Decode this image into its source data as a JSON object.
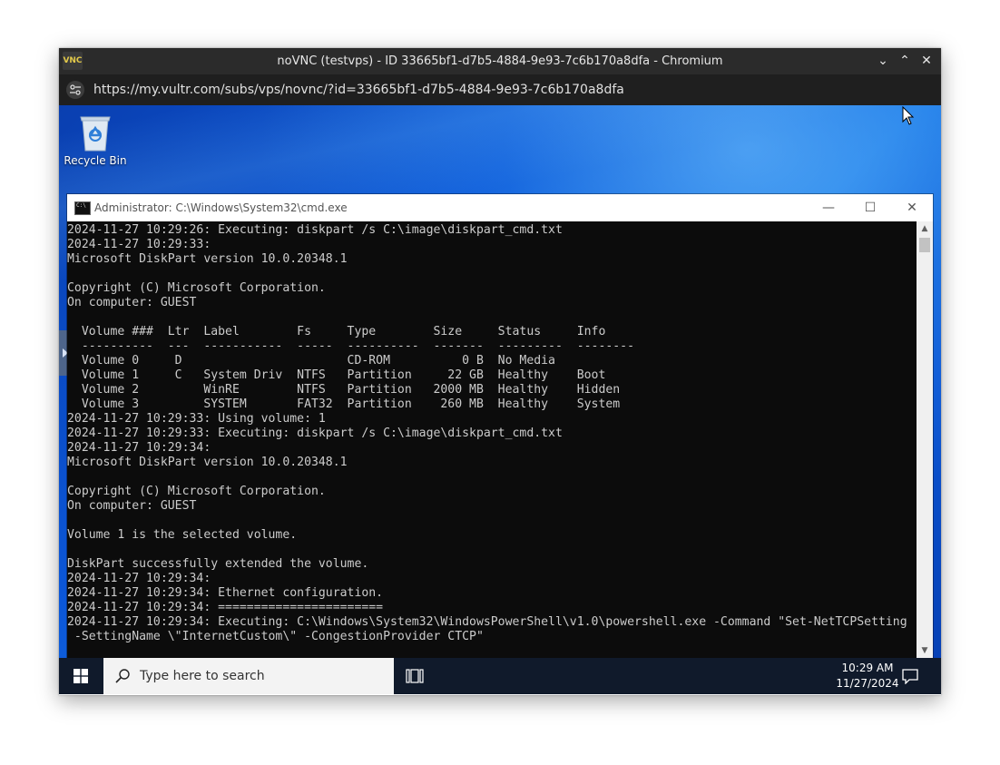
{
  "browser": {
    "title": "noVNC (testvps) - ID 33665bf1-d7b5-4884-9e93-7c6b170a8dfa - Chromium",
    "app_icon_text": "VNC",
    "url": "https://my.vultr.com/subs/vps/novnc/?id=33665bf1-d7b5-4884-9e93-7c6b170a8dfa",
    "controls": {
      "minimize": "⌄",
      "maximize": "⌃",
      "close": "✕"
    }
  },
  "desktop": {
    "recycle_bin_label": "Recycle Bin"
  },
  "cmd_window": {
    "title": "Administrator: C:\\Windows\\System32\\cmd.exe",
    "buttons": {
      "minimize": "—",
      "maximize": "☐",
      "close": "✕"
    },
    "console_text": "2024-11-27 10:29:26: Executing: diskpart /s C:\\image\\diskpart_cmd.txt\n2024-11-27 10:29:33:\nMicrosoft DiskPart version 10.0.20348.1\n\nCopyright (C) Microsoft Corporation.\nOn computer: GUEST\n\n  Volume ###  Ltr  Label        Fs     Type        Size     Status     Info\n  ----------  ---  -----------  -----  ----------  -------  ---------  --------\n  Volume 0     D                       CD-ROM          0 B  No Media\n  Volume 1     C   System Driv  NTFS   Partition     22 GB  Healthy    Boot\n  Volume 2         WinRE        NTFS   Partition   2000 MB  Healthy    Hidden\n  Volume 3         SYSTEM       FAT32  Partition    260 MB  Healthy    System\n2024-11-27 10:29:33: Using volume: 1\n2024-11-27 10:29:33: Executing: diskpart /s C:\\image\\diskpart_cmd.txt\n2024-11-27 10:29:34:\nMicrosoft DiskPart version 10.0.20348.1\n\nCopyright (C) Microsoft Corporation.\nOn computer: GUEST\n\nVolume 1 is the selected volume.\n\nDiskPart successfully extended the volume.\n2024-11-27 10:29:34:\n2024-11-27 10:29:34: Ethernet configuration.\n2024-11-27 10:29:34: =======================\n2024-11-27 10:29:34: Executing: C:\\Windows\\System32\\WindowsPowerShell\\v1.0\\powershell.exe -Command \"Set-NetTCPSetting\n -SettingName \\\"InternetCustom\\\" -CongestionProvider CTCP\""
  },
  "taskbar": {
    "search_placeholder": "Type here to search",
    "time": "10:29 AM",
    "date": "11/27/2024"
  },
  "colors": {
    "console_bg": "#0c0c0c",
    "console_fg": "#cccccc",
    "taskbar_bg": "#101a2b",
    "chrome_bar": "#2b2b2b"
  }
}
